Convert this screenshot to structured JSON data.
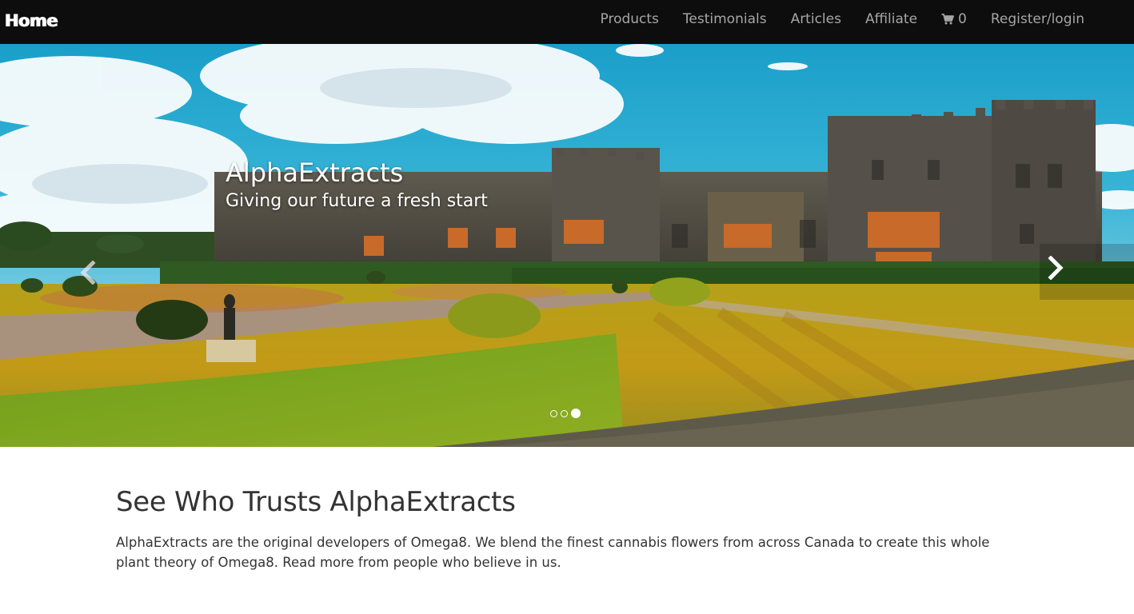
{
  "navbar": {
    "brand": "Home",
    "links": {
      "products": "Products",
      "testimonials": "Testimonials",
      "articles": "Articles",
      "affiliate": "Affiliate",
      "cart_count": "0",
      "register_login": "Register/login"
    },
    "cart_icon": "shopping-cart-icon",
    "background": "#0d0d0d",
    "link_color": "#a6a6a6"
  },
  "hero": {
    "title": "AlphaExtracts",
    "subtitle": "Giving our future a fresh start",
    "prev_icon": "chevron-left-icon",
    "next_icon": "chevron-right-icon",
    "slide_count": 3,
    "active_slide": 3
  },
  "trust": {
    "heading": "See Who Trusts AlphaExtracts",
    "body": "AlphaExtracts are the original developers of Omega8. We blend the finest cannabis flowers from across Canada to create this whole plant theory of Omega8. Read more from people who believe in us."
  }
}
